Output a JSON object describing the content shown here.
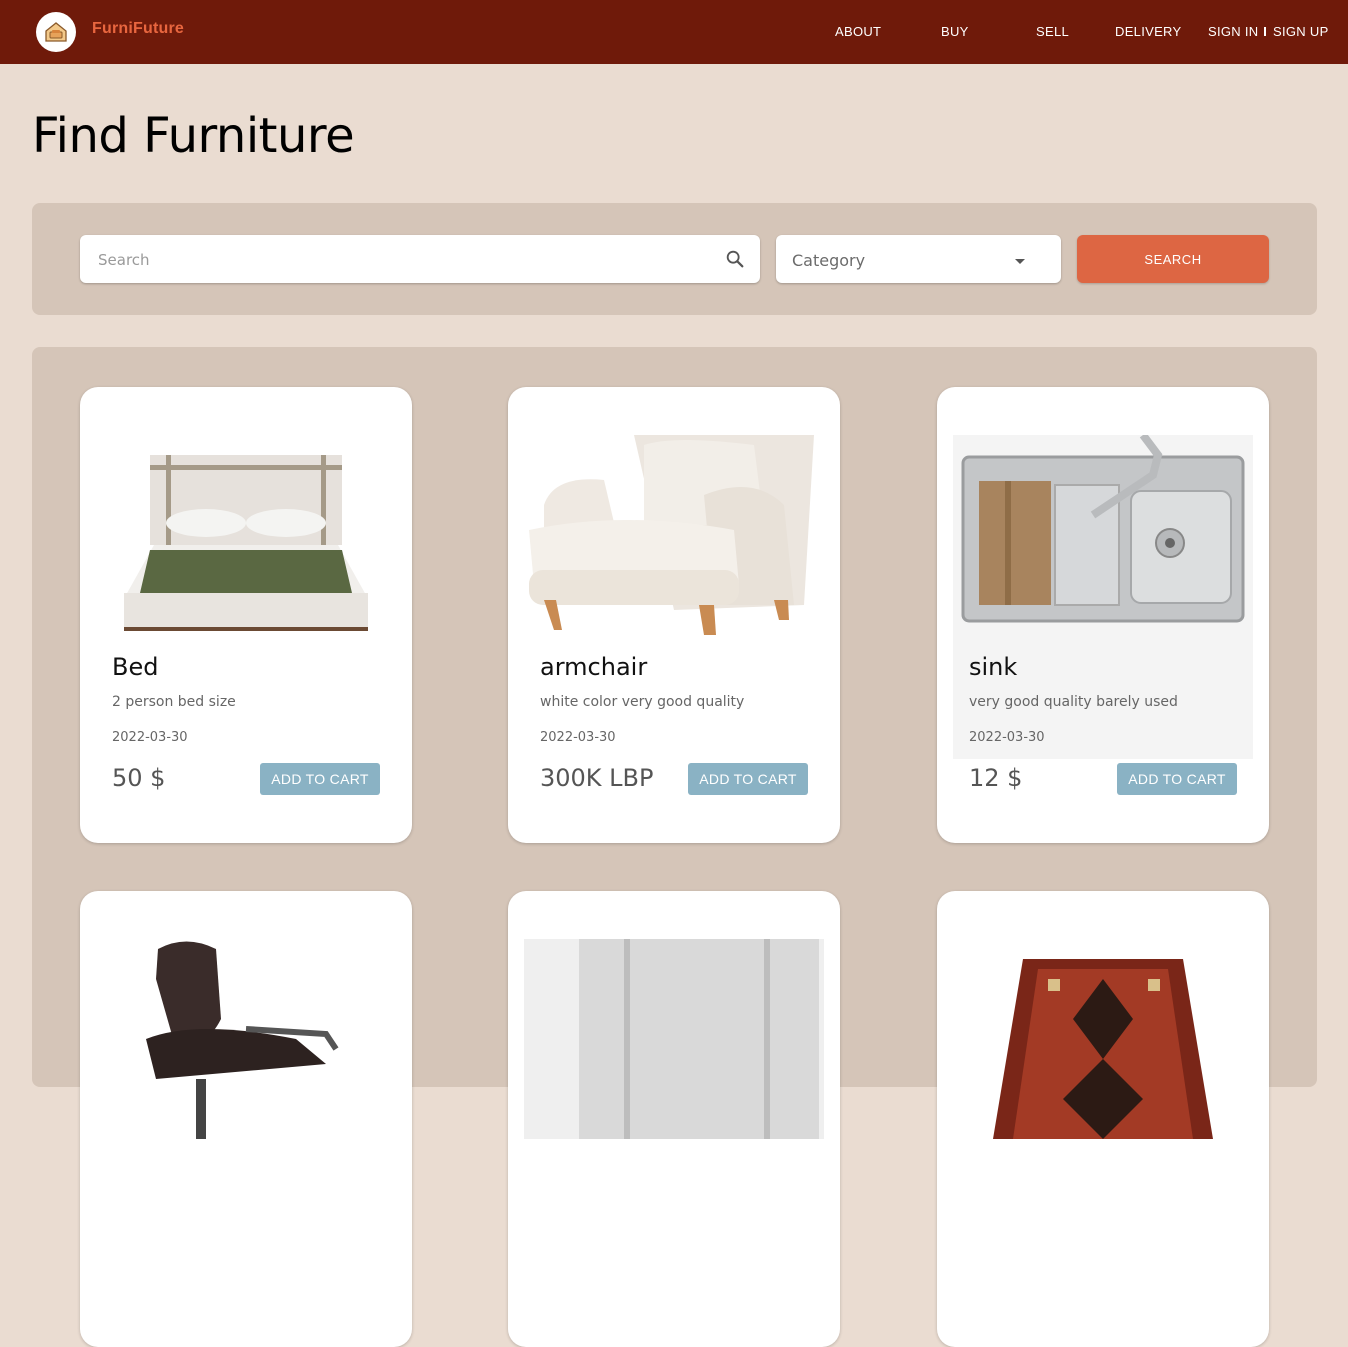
{
  "header": {
    "brand": "FurniFuture",
    "nav": [
      "ABOUT",
      "BUY",
      "SELL",
      "DELIVERY"
    ],
    "sign_in": "SIGN IN",
    "sign_up": "SIGN UP"
  },
  "page_title": "Find Furniture",
  "search": {
    "placeholder": "Search",
    "category_placeholder": "Category",
    "button": "SEARCH"
  },
  "cards": [
    {
      "name": "Bed",
      "description": "2 person bed size",
      "date": "2022-03-30",
      "price": "50 $",
      "button": "ADD TO CART",
      "image": "bed"
    },
    {
      "name": "armchair",
      "description": "white color very good quality",
      "date": "2022-03-30",
      "price": "300K LBP",
      "button": "ADD TO CART",
      "image": "armchair"
    },
    {
      "name": "sink",
      "description": "very good quality barely used",
      "date": "2022-03-30",
      "price": "12 $",
      "button": "ADD TO CART",
      "image": "sink"
    },
    {
      "image": "office-chair"
    },
    {
      "image": "refrigerator"
    },
    {
      "image": "rug"
    }
  ],
  "colors": {
    "header_bg": "#6f1a0a",
    "brand": "#e8663f",
    "page_bg": "#eadcd1",
    "panel_bg": "#d5c5b8",
    "search_button": "#dd6643",
    "cart_button": "#8ab2c4"
  }
}
